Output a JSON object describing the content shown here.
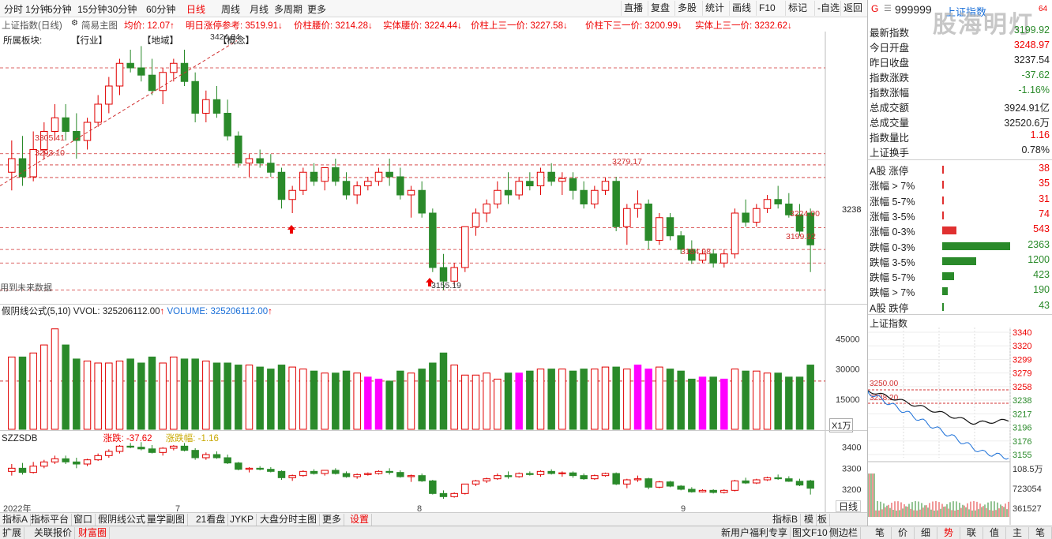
{
  "topbar": {
    "periods": [
      "分时",
      "1分钟",
      "5分钟",
      "15分钟",
      "30分钟",
      "60分钟",
      "日线",
      "周线",
      "月线",
      "多周期",
      "更多"
    ],
    "active_period": "日线",
    "right_buttons": [
      "直播",
      "复盘",
      "多股",
      "统计",
      "画线",
      "F10",
      "标记",
      "-自选",
      "返回"
    ]
  },
  "indicator_row": {
    "title": "上证指数(日线)",
    "main_label": "简易主图",
    "items": [
      {
        "text": "均价: 12.07↑",
        "color": "red"
      },
      {
        "text": "明日涨停参考: 3519.91↓",
        "color": "red"
      },
      {
        "text": "价柱腰价: 3214.28↓",
        "color": "red"
      },
      {
        "text": "实体腰价: 3224.44↓",
        "color": "red"
      },
      {
        "text": "价柱上三一价: 3227.58↓",
        "color": "red"
      },
      {
        "text": "价柱下三一价: 3200.99↓",
        "color": "red"
      },
      {
        "text": "实体上三一价: 3232.62↓",
        "color": "red"
      }
    ],
    "sector_labels": [
      "所属板块:",
      "【行业】",
      "【地域】",
      "【概念】"
    ]
  },
  "main_chart": {
    "ref_lines": [
      3305.41,
      3293.1,
      3279.17,
      3224.0,
      3199.92,
      3184.98,
      3155.19,
      3400
    ],
    "annotations": [
      "3305.41",
      "3293.10",
      "3279.17",
      "3224.00",
      "3199.92",
      "3184.98",
      "3155.19",
      "3424.84"
    ],
    "right_axis_label": "3238",
    "note": "用到未来数据"
  },
  "chart_data": {
    "type": "candlestick",
    "title": "上证指数(日线)",
    "x_labels": [
      "2022年",
      "7",
      "8",
      "9"
    ],
    "y_axis_labels": [
      "3238"
    ],
    "ohlc": [
      [
        3285,
        3320,
        3265,
        3300
      ],
      [
        3300,
        3325,
        3270,
        3280
      ],
      [
        3280,
        3330,
        3275,
        3310
      ],
      [
        3310,
        3340,
        3300,
        3330
      ],
      [
        3330,
        3360,
        3320,
        3345
      ],
      [
        3345,
        3360,
        3320,
        3330
      ],
      [
        3330,
        3350,
        3300,
        3320
      ],
      [
        3320,
        3345,
        3310,
        3340
      ],
      [
        3340,
        3370,
        3335,
        3360
      ],
      [
        3360,
        3390,
        3350,
        3380
      ],
      [
        3380,
        3410,
        3370,
        3405
      ],
      [
        3405,
        3420,
        3395,
        3400
      ],
      [
        3400,
        3424,
        3385,
        3392
      ],
      [
        3392,
        3410,
        3370,
        3375
      ],
      [
        3375,
        3400,
        3360,
        3395
      ],
      [
        3395,
        3410,
        3385,
        3405
      ],
      [
        3405,
        3420,
        3380,
        3385
      ],
      [
        3385,
        3395,
        3340,
        3350
      ],
      [
        3350,
        3375,
        3340,
        3365
      ],
      [
        3365,
        3380,
        3345,
        3350
      ],
      [
        3350,
        3365,
        3320,
        3325
      ],
      [
        3325,
        3330,
        3290,
        3295
      ],
      [
        3295,
        3305,
        3280,
        3300
      ],
      [
        3300,
        3310,
        3290,
        3295
      ],
      [
        3295,
        3305,
        3280,
        3285
      ],
      [
        3285,
        3290,
        3245,
        3255
      ],
      [
        3255,
        3270,
        3240,
        3265
      ],
      [
        3265,
        3290,
        3260,
        3285
      ],
      [
        3285,
        3295,
        3270,
        3275
      ],
      [
        3275,
        3290,
        3265,
        3290
      ],
      [
        3290,
        3300,
        3270,
        3275
      ],
      [
        3275,
        3285,
        3255,
        3260
      ],
      [
        3260,
        3275,
        3250,
        3270
      ],
      [
        3270,
        3280,
        3265,
        3275
      ],
      [
        3275,
        3290,
        3270,
        3285
      ],
      [
        3285,
        3300,
        3270,
        3280
      ],
      [
        3280,
        3290,
        3255,
        3260
      ],
      [
        3260,
        3270,
        3235,
        3265
      ],
      [
        3265,
        3275,
        3235,
        3240
      ],
      [
        3240,
        3245,
        3175,
        3180
      ],
      [
        3180,
        3195,
        3155,
        3165
      ],
      [
        3165,
        3185,
        3160,
        3180
      ],
      [
        3180,
        3225,
        3175,
        3225
      ],
      [
        3225,
        3245,
        3215,
        3240
      ],
      [
        3240,
        3255,
        3230,
        3250
      ],
      [
        3250,
        3275,
        3245,
        3265
      ],
      [
        3265,
        3285,
        3250,
        3260
      ],
      [
        3260,
        3280,
        3255,
        3275
      ],
      [
        3275,
        3285,
        3265,
        3270
      ],
      [
        3270,
        3290,
        3260,
        3285
      ],
      [
        3285,
        3295,
        3270,
        3275
      ],
      [
        3275,
        3285,
        3260,
        3278
      ],
      [
        3278,
        3285,
        3255,
        3265
      ],
      [
        3265,
        3275,
        3245,
        3250
      ],
      [
        3250,
        3270,
        3245,
        3265
      ],
      [
        3265,
        3279,
        3260,
        3275
      ],
      [
        3275,
        3280,
        3220,
        3225
      ],
      [
        3225,
        3250,
        3205,
        3245
      ],
      [
        3245,
        3265,
        3235,
        3250
      ],
      [
        3250,
        3255,
        3200,
        3210
      ],
      [
        3210,
        3240,
        3205,
        3235
      ],
      [
        3235,
        3240,
        3210,
        3215
      ],
      [
        3215,
        3220,
        3195,
        3200
      ],
      [
        3200,
        3210,
        3184,
        3188
      ],
      [
        3188,
        3200,
        3185,
        3195
      ],
      [
        3195,
        3200,
        3180,
        3185
      ],
      [
        3185,
        3200,
        3180,
        3195
      ],
      [
        3195,
        3245,
        3190,
        3240
      ],
      [
        3240,
        3255,
        3225,
        3230
      ],
      [
        3230,
        3250,
        3225,
        3245
      ],
      [
        3245,
        3260,
        3240,
        3255
      ],
      [
        3255,
        3270,
        3245,
        3250
      ],
      [
        3250,
        3262,
        3235,
        3238
      ],
      [
        3238,
        3250,
        3215,
        3220
      ],
      [
        3240,
        3245,
        3175,
        3205
      ]
    ],
    "volume": {
      "title": "假阴线公式(5,10)",
      "vvol": "325206112.00",
      "volume_label": "VOLUME: 325206112.00",
      "y_axis_labels": [
        "45000",
        "30000",
        "15000"
      ],
      "unit_label": "X1万"
    },
    "sub": {
      "title": "SZZSDB",
      "change_label": "涨跌: -37.62",
      "pct_label": "涨跌幅: -1.16",
      "y_axis_labels": [
        "3400",
        "3300",
        "3200"
      ]
    }
  },
  "bottom_tabs": [
    "指标A",
    "指标平台",
    "窗口",
    "假阴线公式",
    "量学副图",
    "21看盘",
    "JYKP",
    "大盘分时主图",
    "更多",
    "设置"
  ],
  "bottom_right": [
    "指标B",
    "模",
    "板"
  ],
  "daily_label": "日线",
  "status_bar": {
    "left": [
      "扩展",
      "关联报价",
      "财富圈"
    ],
    "right": [
      "新用户福利专享",
      "图文F10",
      "侧边栏"
    ],
    "nav": [
      "笔",
      "价",
      "细",
      "势",
      "联",
      "值",
      "主",
      "笔"
    ]
  },
  "right_panel": {
    "code": "999999",
    "name": "上证指数",
    "watermark": "股海明灯",
    "badge": "64",
    "rows": [
      {
        "k": "最新指数",
        "v": "3199.92",
        "color": "green"
      },
      {
        "k": "今日开盘",
        "v": "3248.97",
        "color": "red"
      },
      {
        "k": "昨日收盘",
        "v": "3237.54",
        "color": "black"
      },
      {
        "k": "指数涨跌",
        "v": "-37.62",
        "color": "green"
      },
      {
        "k": "指数涨幅",
        "v": "-1.16%",
        "color": "green"
      },
      {
        "k": "总成交额",
        "v": "3924.91亿",
        "color": "black"
      },
      {
        "k": "总成交量",
        "v": "32520.6万",
        "color": "black"
      },
      {
        "k": "指数量比",
        "v": "1.16",
        "color": "red"
      },
      {
        "k": "上证换手",
        "v": "0.78%",
        "color": "black"
      }
    ],
    "breadth": [
      {
        "k": "A股 涨停",
        "v": "38",
        "color": "red",
        "bar": 0.01
      },
      {
        "k": "涨幅 > 7%",
        "v": "35",
        "color": "red",
        "bar": 0.01
      },
      {
        "k": "涨幅 5-7%",
        "v": "31",
        "color": "red",
        "bar": 0.01
      },
      {
        "k": "涨幅 3-5%",
        "v": "74",
        "color": "red",
        "bar": 0.02
      },
      {
        "k": "涨幅 0-3%",
        "v": "543",
        "color": "red",
        "bar": 0.2
      },
      {
        "k": "跌幅 0-3%",
        "v": "2363",
        "color": "green",
        "bar": 0.95
      },
      {
        "k": "跌幅 3-5%",
        "v": "1200",
        "color": "green",
        "bar": 0.48
      },
      {
        "k": "跌幅 5-7%",
        "v": "423",
        "color": "green",
        "bar": 0.17
      },
      {
        "k": "跌幅 > 7%",
        "v": "190",
        "color": "green",
        "bar": 0.08
      },
      {
        "k": "A股 跌停",
        "v": "43",
        "color": "green",
        "bar": 0.01
      }
    ],
    "mini_title": "上证指数",
    "mini_axis": [
      "3340",
      "3320",
      "3299",
      "3279",
      "3258",
      "3238",
      "3217",
      "3196",
      "3176",
      "3155"
    ],
    "mini_ref": [
      "3250.00",
      "3238.20"
    ],
    "mini_vol_axis": [
      "108.5万",
      "723054",
      "361527"
    ]
  },
  "colors": {
    "up": "#e00000",
    "down": "#2a8a2a",
    "magenta": "#ff00ff",
    "yellow": "#ffff44",
    "ref": "#d03030"
  }
}
